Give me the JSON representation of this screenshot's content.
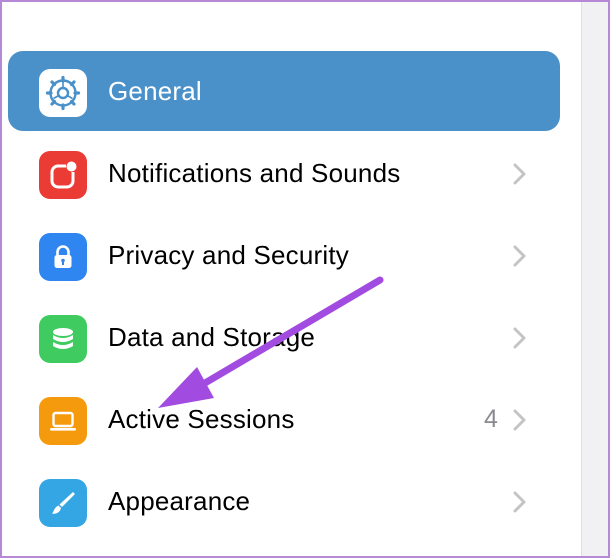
{
  "colors": {
    "selected_bg": "#4a90c9",
    "annotation_arrow": "#a24be0",
    "frame_border": "#b689d6"
  },
  "settings": {
    "items": [
      {
        "label": "General",
        "icon": "gear-icon",
        "icon_bg": "#ffffff",
        "selected": true
      },
      {
        "label": "Notifications and Sounds",
        "icon": "notification-badge-icon",
        "icon_bg": "#ea3b35",
        "selected": false
      },
      {
        "label": "Privacy and Security",
        "icon": "lock-icon",
        "icon_bg": "#2f86f0",
        "selected": false
      },
      {
        "label": "Data and Storage",
        "icon": "database-icon",
        "icon_bg": "#3fcb5f",
        "selected": false
      },
      {
        "label": "Active Sessions",
        "icon": "laptop-icon",
        "icon_bg": "#f59a0c",
        "selected": false,
        "badge": "4"
      },
      {
        "label": "Appearance",
        "icon": "brush-icon",
        "icon_bg": "#35a6e4",
        "selected": false
      }
    ]
  }
}
